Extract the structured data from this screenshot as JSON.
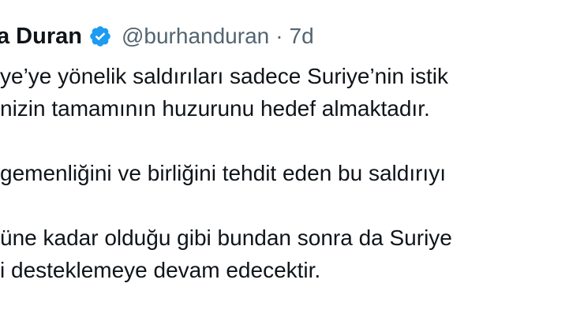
{
  "tweet": {
    "display_name": "a Duran",
    "handle": "@burhanduran",
    "separator": "·",
    "timestamp": "7d",
    "verified_icon": "verified-badge-icon",
    "accent_color": "#1d9bf0",
    "lines": [
      "ye’ye yönelik saldırıları sadece Suriye’nin istik",
      "nizin tamamının huzurunu hedef almaktadır.",
      "",
      "gemenliğini ve birliğini tehdit eden bu saldırıyı",
      "",
      "üne kadar olduğu gibi bundan sonra da Suriye",
      "i desteklemeye devam edecektir."
    ]
  }
}
